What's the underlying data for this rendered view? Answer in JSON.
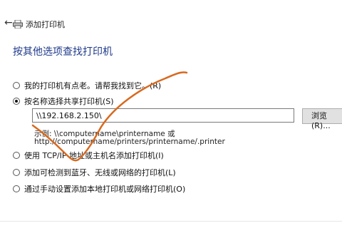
{
  "window": {
    "title": "添加打印机"
  },
  "heading": "按其他选项查找打印机",
  "options": {
    "not_listed": "我的打印机有点老。请帮我找到它。(R)",
    "by_name": "按名称选择共享打印机(S)",
    "tcp_ip": "使用 TCP/IP 地址或主机名添加打印机(I)",
    "bluetooth": "添加可检测到蓝牙、无线或网络的打印机(L)",
    "manual": "通过手动设置添加本地打印机或网络打印机(O)"
  },
  "share_input": {
    "value": "\\\\192.168.2.150\\"
  },
  "browse_label": "浏览(R)...",
  "example": {
    "line1": "示例: \\\\computername\\printername 或",
    "line2": "http://computername/printers/printername/.printer"
  },
  "colors": {
    "heading": "#1f3a8a",
    "annotation_stroke": "#d8691f"
  },
  "icons": {
    "back": "back-arrow-icon",
    "printer": "printer-icon"
  }
}
